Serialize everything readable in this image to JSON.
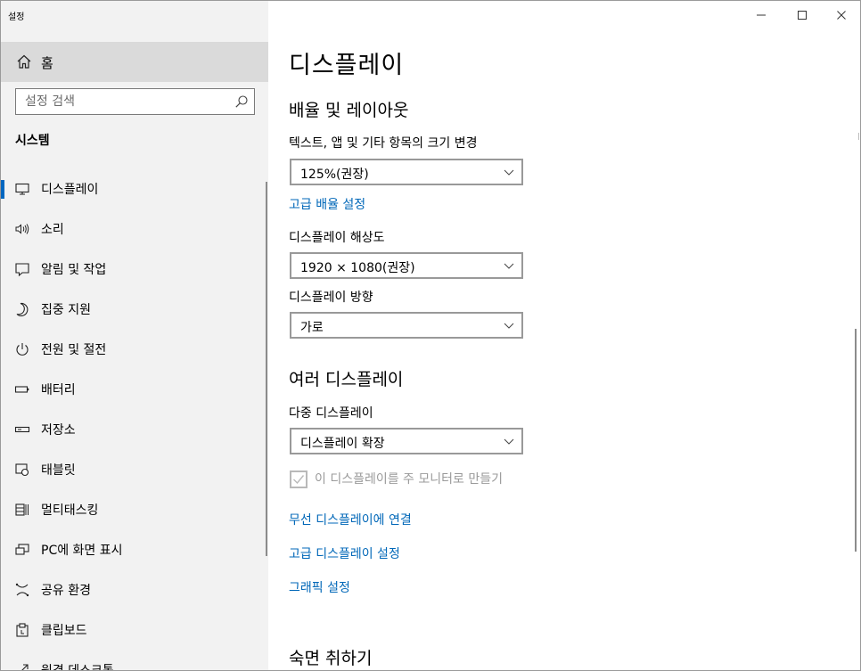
{
  "window": {
    "title": "설정",
    "controls": {
      "minimize": "minimize-icon",
      "maximize": "maximize-icon",
      "close": "close-icon"
    }
  },
  "sidebar": {
    "home_label": "홈",
    "search_placeholder": "설정 검색",
    "section_title": "시스템",
    "items": [
      {
        "label": "디스플레이",
        "icon": "monitor-icon",
        "selected": true
      },
      {
        "label": "소리",
        "icon": "speaker-icon"
      },
      {
        "label": "알림 및 작업",
        "icon": "notification-icon"
      },
      {
        "label": "집중 지원",
        "icon": "moon-icon"
      },
      {
        "label": "전원 및 절전",
        "icon": "power-icon"
      },
      {
        "label": "배터리",
        "icon": "battery-icon"
      },
      {
        "label": "저장소",
        "icon": "storage-icon"
      },
      {
        "label": "태블릿",
        "icon": "tablet-icon"
      },
      {
        "label": "멀티태스킹",
        "icon": "multitasking-icon"
      },
      {
        "label": "PC에 화면 표시",
        "icon": "project-icon"
      },
      {
        "label": "공유 환경",
        "icon": "shared-experiences-icon"
      },
      {
        "label": "클립보드",
        "icon": "clipboard-icon"
      },
      {
        "label": "원격 데스크톱",
        "icon": "remote-desktop-icon"
      }
    ]
  },
  "main": {
    "page_title": "디스플레이",
    "scale_section": {
      "heading": "배율 및 레이아웃",
      "text_size_label": "텍스트, 앱 및 기타 항목의 크기 변경",
      "text_size_value": "125%(권장)",
      "advanced_scaling_link": "고급 배율 설정",
      "resolution_label": "디스플레이 해상도",
      "resolution_value": "1920 × 1080(권장)",
      "orientation_label": "디스플레이 방향",
      "orientation_value": "가로"
    },
    "multi_section": {
      "heading": "여러 디스플레이",
      "multi_label": "다중 디스플레이",
      "multi_value": "디스플레이 확장",
      "main_display_checkbox_label": "이 디스플레이를 주 모니터로 만들기",
      "main_display_checked": true,
      "wireless_link": "무선 디스플레이에 연결",
      "advanced_display_link": "고급 디스플레이 설정",
      "graphics_link": "그래픽 설정"
    },
    "sleep_heading": "숙면 취하기"
  },
  "colors": {
    "accent": "#0067c0",
    "link": "#0067b8",
    "sidebar_bg": "#f2f2f2",
    "home_bg": "#dadada"
  }
}
